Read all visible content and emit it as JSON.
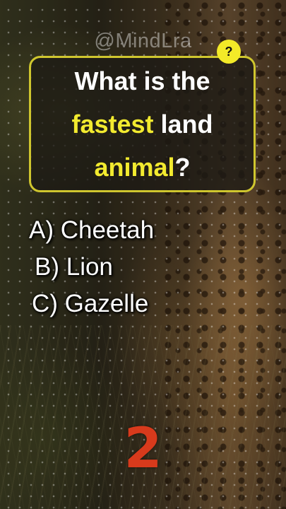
{
  "watermark": "@MindLra",
  "question": {
    "parts": [
      {
        "text": "What is the",
        "highlight": false
      },
      {
        "text": "fastest",
        "highlight": true
      },
      {
        "text": " land",
        "highlight": false
      },
      {
        "text": "animal",
        "highlight": true
      },
      {
        "text": "?",
        "highlight": false
      }
    ],
    "badge": "?"
  },
  "options": [
    {
      "label": "A) Cheetah"
    },
    {
      "label": "B) Lion"
    },
    {
      "label": "C) Gazelle"
    }
  ],
  "timer": "2",
  "colors": {
    "accent": "#f2ea2f",
    "border": "#cfc62e",
    "timer": "#d83a1c",
    "text": "#ffffff"
  }
}
